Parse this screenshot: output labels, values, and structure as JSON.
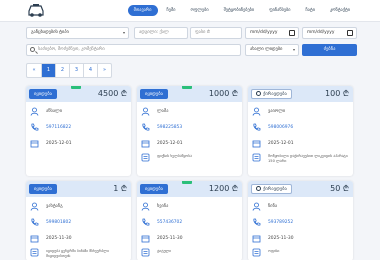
{
  "nav": {
    "items": [
      "მთავარი",
      "ჩემი",
      "ოფლები",
      "შეტყობინებები",
      "ფინანსები",
      "ჩატი",
      "კონტაქტი"
    ],
    "active_index": 0
  },
  "filters": {
    "category_select": "განცხადების ტიპი",
    "place_input_placeholder": "ადგილი: ქალ",
    "price_input_placeholder": "ფასი ₾",
    "date_from_placeholder": "mm/dd/yyyy",
    "date_to_placeholder": "mm/dd/yyyy",
    "search_placeholder": "საძიებო, მოძებნეთ, კომენტარი",
    "sort_select": "ახალი ლიდები",
    "search_button": "ძებნა"
  },
  "pagination": {
    "prev": "«",
    "pages": [
      "1",
      "2",
      "3",
      "4"
    ],
    "active": "1",
    "next": "»"
  },
  "colors": {
    "primary": "#2f6fd3",
    "card_head": "#dce8f8",
    "badge": "#2bbf7a"
  },
  "cards": [
    {
      "tag": "იყიდება",
      "tag_style": "blue",
      "price": "4500 ₾",
      "name": "ანსალი",
      "phone": "597116822",
      "date": "2025-12-01",
      "desc": "",
      "badge": true
    },
    {
      "tag": "იყიდება",
      "tag_style": "blue",
      "price": "1000 ₾",
      "name": "ლამა",
      "phone": "598225853",
      "date": "2025-12-01",
      "desc": "ფიქსის ხელსაწყოსა",
      "badge": true
    },
    {
      "tag": "ქირავდება",
      "tag_style": "white",
      "price": "100 ₾",
      "name": "ვაიოლი",
      "phone": "598006976",
      "date": "2025-12-01",
      "desc": "მოწყობილი დაქირავებით ლიკვიდის აპარატი 150 ლარი",
      "badge": false
    },
    {
      "tag": "იყიდება",
      "tag_style": "blue",
      "price": "1 ₾",
      "name": "ვახტანგ",
      "phone": "599801802",
      "date": "2025-11-30",
      "desc": "იყიდება ცენტრში ბინაში მსხვერპლი მიყიდვისთვის",
      "badge": false
    },
    {
      "tag": "იყიდება",
      "tag_style": "blue",
      "price": "1200 ₾",
      "name": "ხვიჩა",
      "phone": "557436702",
      "date": "2025-11-30",
      "desc": "ტიტული",
      "badge": true
    },
    {
      "tag": "ქირავდება",
      "tag_style": "white",
      "price": "50 ₾",
      "name": "ნინა",
      "phone": "593789252",
      "date": "2025-11-30",
      "desc": "ოფისი",
      "badge": false
    }
  ]
}
